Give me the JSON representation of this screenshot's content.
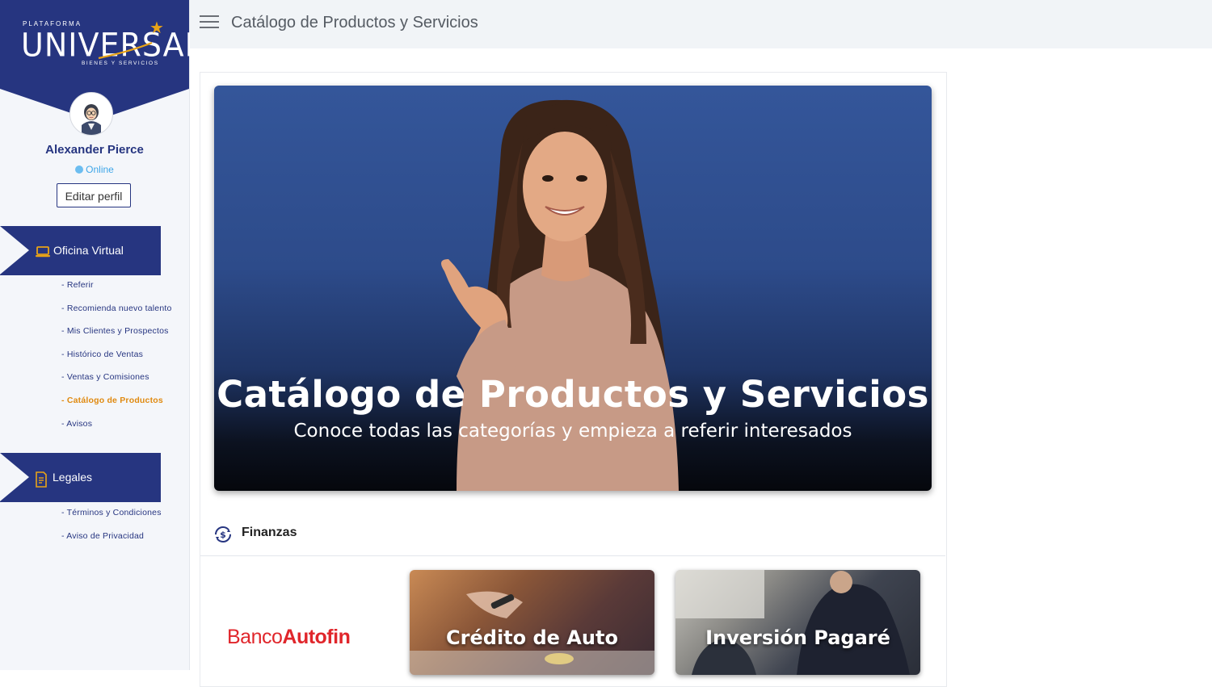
{
  "brand": {
    "small_text": "PLATAFORMA",
    "main_text": "UNIVERSAL",
    "sub_text": "BIENES Y SERVICIOS",
    "primary_color": "#263580",
    "accent_color": "#e8a317"
  },
  "user": {
    "name": "Alexander Pierce",
    "status": "Online",
    "edit_label": "Editar perfil"
  },
  "sidebar": {
    "sections": [
      {
        "title": "Oficina Virtual",
        "icon": "laptop-icon",
        "items": [
          {
            "label": "- Referir"
          },
          {
            "label": "- Recomienda nuevo talento"
          },
          {
            "label": "- Mis Clientes y Prospectos"
          },
          {
            "label": "- Histórico de Ventas"
          },
          {
            "label": "- Ventas y Comisiones"
          },
          {
            "label": "- Catálogo de Productos",
            "active": true
          },
          {
            "label": "- Avisos"
          }
        ]
      },
      {
        "title": "Legales",
        "icon": "document-icon",
        "items": [
          {
            "label": "- Términos y Condiciones"
          },
          {
            "label": "- Aviso de Privacidad"
          }
        ]
      }
    ]
  },
  "header": {
    "title": "Catálogo de Productos y Servicios",
    "menu_icon": "hamburger-icon"
  },
  "hero": {
    "title": "Catálogo de Productos y Servicios",
    "subtitle": "Conoce todas las categorías y empieza a referir interesados"
  },
  "category": {
    "title": "Finanzas",
    "icon": "money-cycle-icon",
    "partner_logo": {
      "part1": "Banco",
      "part2": "Autofin"
    },
    "products": [
      {
        "label": "Crédito de Auto"
      },
      {
        "label": "Inversión Pagaré"
      }
    ]
  }
}
